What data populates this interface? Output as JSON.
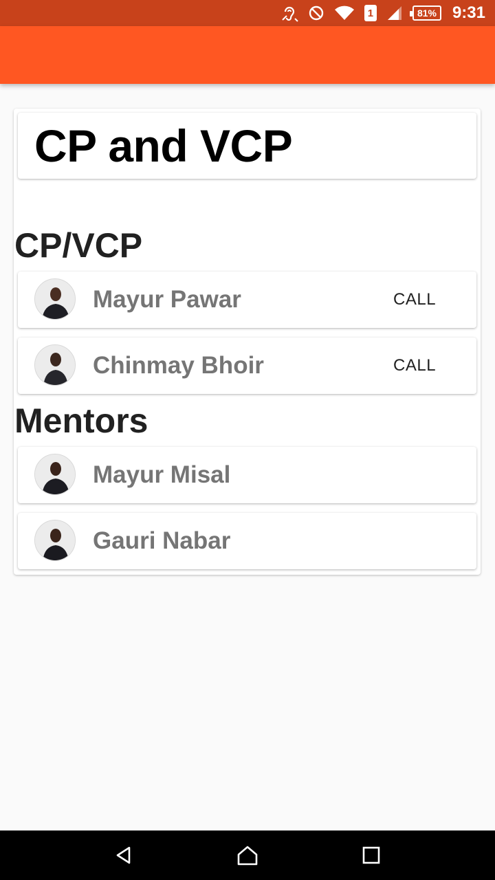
{
  "status_bar": {
    "time": "9:31",
    "battery_percent": "81%",
    "sim_slot": "1",
    "icons": [
      "hearing-aid-icon",
      "do-not-disturb-icon",
      "wifi-icon",
      "sim-icon",
      "cellular-signal-icon",
      "battery-icon"
    ]
  },
  "theme": {
    "app_bar_color": "#ff5722",
    "status_bar_color": "#c8421b"
  },
  "page": {
    "title": "CP and VCP"
  },
  "sections": [
    {
      "heading": "CP/VCP",
      "people": [
        {
          "name": "Mayur Pawar",
          "action": "CALL"
        },
        {
          "name": "Chinmay Bhoir",
          "action": "CALL"
        }
      ]
    },
    {
      "heading": "Mentors",
      "people": [
        {
          "name": "Mayur Misal"
        },
        {
          "name": "Gauri Nabar"
        }
      ]
    }
  ],
  "nav_bar": {
    "icons": [
      "back-icon",
      "home-icon",
      "recents-icon"
    ]
  }
}
